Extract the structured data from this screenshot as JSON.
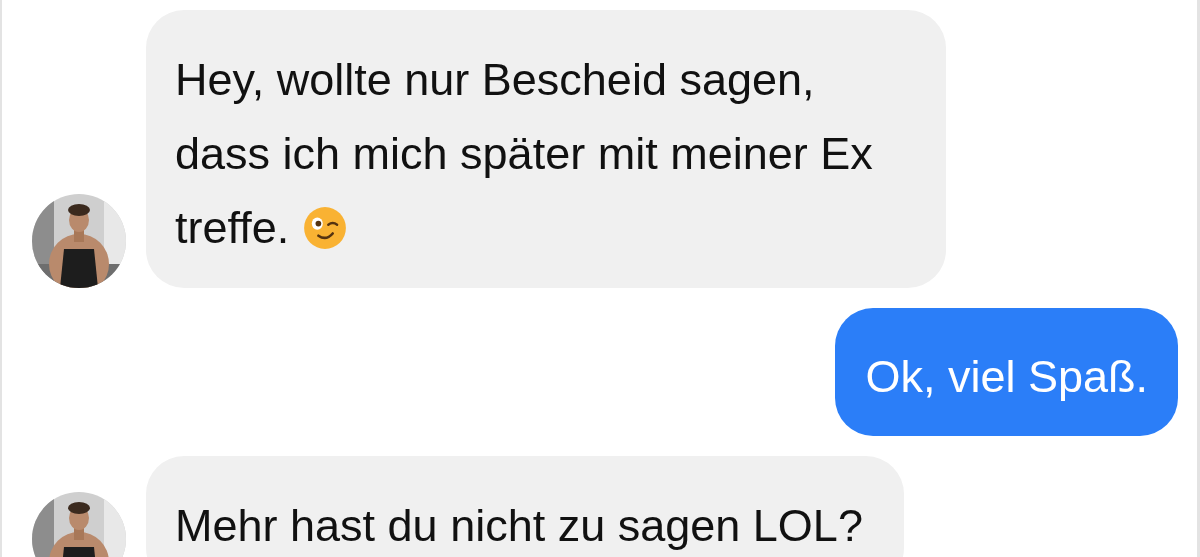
{
  "messages": [
    {
      "kind": "incoming",
      "lines": [
        "Hey, wollte nur Bescheid sagen,",
        "dass ich mich später mit meiner Ex",
        "treffe."
      ],
      "winking_emoji": true
    },
    {
      "kind": "outgoing",
      "lines": [
        "Ok, viel Spaß."
      ]
    },
    {
      "kind": "incoming",
      "lines": [
        "Mehr hast du nicht zu sagen LOL?"
      ]
    }
  ]
}
